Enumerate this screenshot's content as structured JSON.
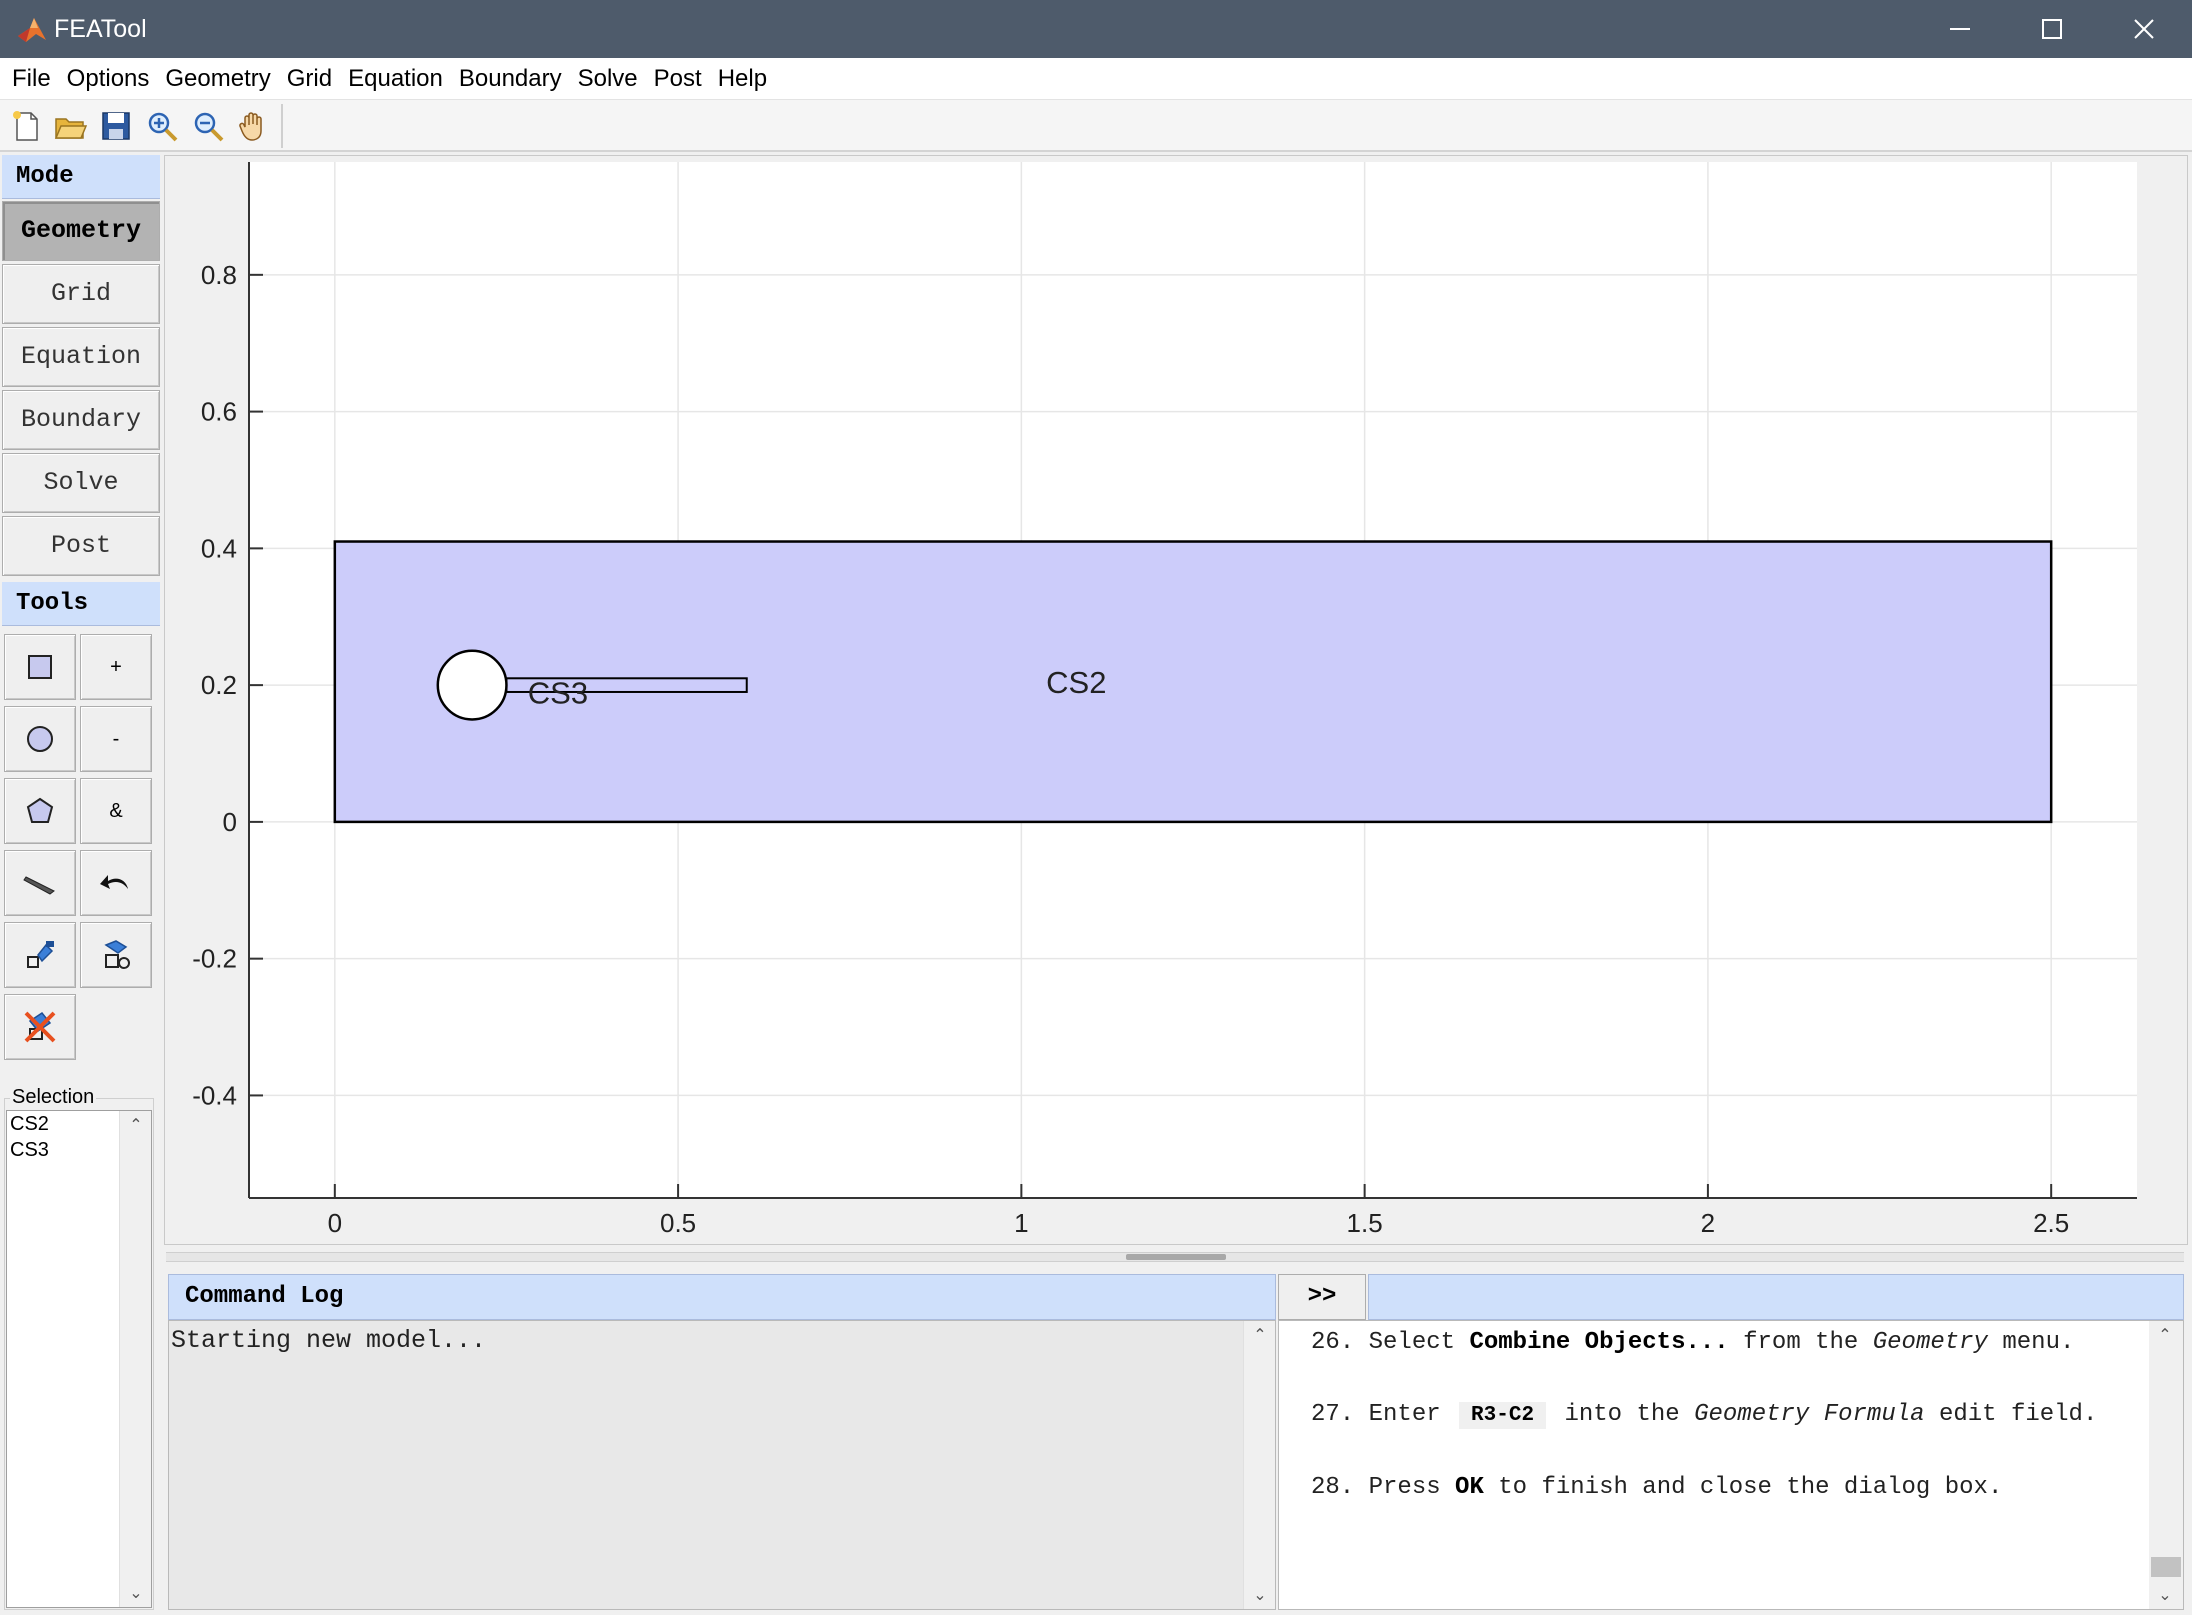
{
  "window": {
    "title": "FEATool",
    "controls": [
      "minimize-icon",
      "maximize-icon",
      "close-icon"
    ]
  },
  "menu": [
    "File",
    "Options",
    "Geometry",
    "Grid",
    "Equation",
    "Boundary",
    "Solve",
    "Post",
    "Help"
  ],
  "toolbar": [
    "new-file-icon",
    "open-folder-icon",
    "save-icon",
    "zoom-in-icon",
    "zoom-out-icon",
    "pan-hand-icon"
  ],
  "left_panel": {
    "mode_header": "Mode",
    "modes": [
      "Geometry",
      "Grid",
      "Equation",
      "Boundary",
      "Solve",
      "Post"
    ],
    "active_mode": "Geometry",
    "tools_header": "Tools",
    "tool_labels": {
      "union": "+",
      "difference": "-",
      "intersection": "&"
    },
    "tool_icons": [
      "rectangle-icon",
      "union-icon",
      "circle-icon",
      "difference-icon",
      "polygon-icon",
      "intersection-icon",
      "line-icon",
      "undo-icon",
      "transform-icon",
      "combine-icon",
      "delete-icon"
    ],
    "selection_label": "Selection",
    "selection_items": [
      "CS2",
      "CS3"
    ]
  },
  "plot": {
    "objects": [
      "CS2",
      "CS3"
    ],
    "x_ticks": [
      "0",
      "0.5",
      "1",
      "1.5",
      "2",
      "2.5"
    ],
    "y_ticks": [
      "0.8",
      "0.6",
      "0.4",
      "0.2",
      "0",
      "-0.2",
      "-0.4"
    ],
    "colors": {
      "fill": "#ccccfa",
      "edge": "#000000",
      "grid": "#e6e6e6"
    }
  },
  "chart_data": {
    "type": "scatter",
    "title": "",
    "xlabel": "",
    "ylabel": "",
    "xlim": [
      -0.125,
      2.625
    ],
    "ylim": [
      -0.55,
      0.965
    ],
    "grid": true,
    "shapes": [
      {
        "name": "CS2",
        "kind": "rectangle-minus-circle",
        "x": [
          0,
          2.5
        ],
        "y": [
          0,
          0.41
        ]
      },
      {
        "name": "CS3",
        "kind": "circle-with-bar",
        "circle_center": [
          0.2,
          0.2
        ],
        "circle_radius": 0.05,
        "bar_x": [
          0.25,
          0.6
        ],
        "bar_y": [
          0.19,
          0.21
        ]
      }
    ]
  },
  "command_log": {
    "title": "Command Log",
    "expand_label": ">>",
    "text": "Starting new model..."
  },
  "help": {
    "step26": {
      "num": "26.",
      "pre": "Select",
      "bold": "Combine Objects...",
      "mid": "from the",
      "ital": "Geometry",
      "post": "menu."
    },
    "step27": {
      "num": "27.",
      "pre": "Enter",
      "code": "R3-C2",
      "mid": "into the",
      "ital": "Geometry Formula",
      "post": "edit field."
    },
    "step28": {
      "num": "28.",
      "pre": "Press",
      "bold": "OK",
      "post": "to finish and close the dialog box."
    }
  }
}
